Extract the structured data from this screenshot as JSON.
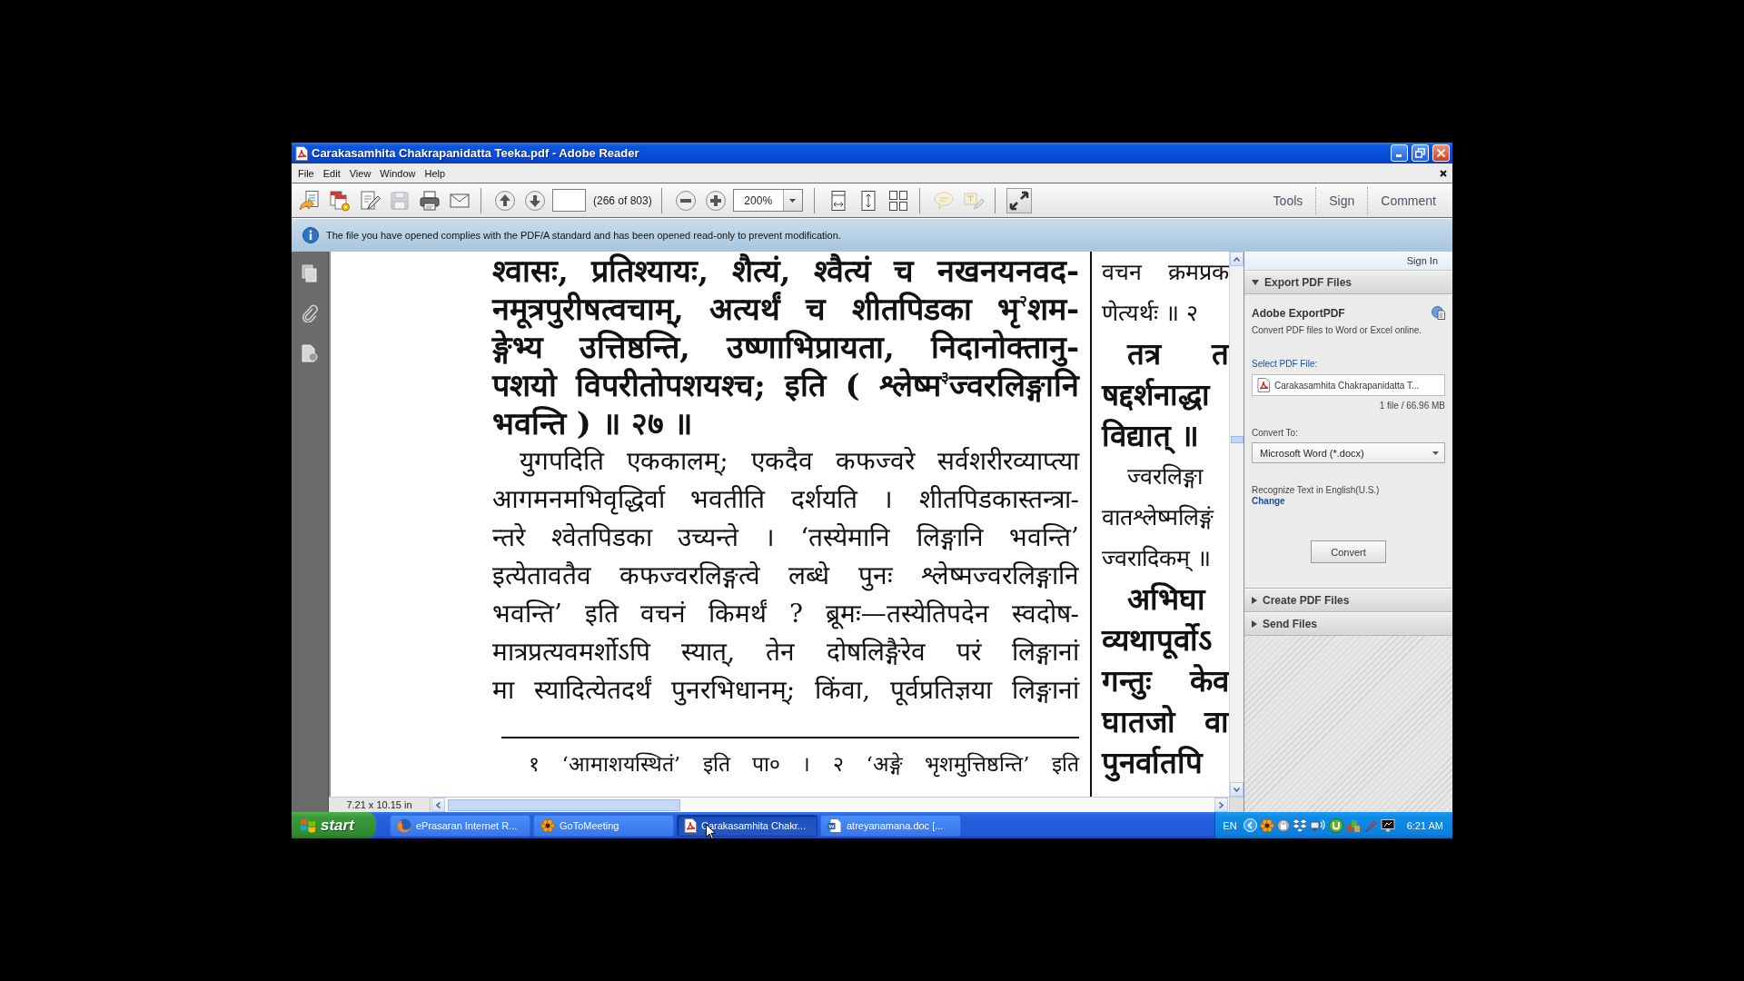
{
  "window": {
    "title": "Carakasamhita Chakrapanidatta Teeka.pdf - Adobe Reader"
  },
  "menu": [
    "File",
    "Edit",
    "View",
    "Window",
    "Help"
  ],
  "toolbar": {
    "file_tools": [
      {
        "kind": "open",
        "disabled": false
      },
      {
        "kind": "create",
        "disabled": false
      },
      {
        "kind": "edit",
        "disabled": false
      },
      {
        "kind": "save",
        "disabled": true
      },
      {
        "kind": "print",
        "disabled": false
      },
      {
        "kind": "email",
        "disabled": false
      }
    ],
    "page_tools": [
      {
        "kind": "previous",
        "disabled": false
      },
      {
        "kind": "next",
        "disabled": false
      }
    ],
    "page_count": "(266 of 803)",
    "zoom_tools": [
      {
        "kind": "zoom_out",
        "disabled": false
      },
      {
        "kind": "zoom_in",
        "disabled": false
      }
    ],
    "zoom": "200%",
    "view_tools": [
      {
        "kind": "fit_width",
        "disabled": false
      },
      {
        "kind": "fit_page",
        "disabled": false
      },
      {
        "kind": "spread",
        "disabled": false
      }
    ],
    "comment_tools": [
      {
        "kind": "note",
        "disabled": true
      },
      {
        "kind": "highlight",
        "disabled": true
      }
    ],
    "mode_tools": [
      {
        "kind": "full_screen",
        "disabled": false
      }
    ],
    "task_buttons": [
      "Tools",
      "Sign",
      "Comment"
    ]
  },
  "notice": "The file you have opened complies with the PDF/A standard and has been opened read-only to prevent modification.",
  "document": {
    "main_column": [
      {
        "kind": "verse",
        "continued": true,
        "runs_on": false,
        "lines": [
          "श्वासः, प्रतिश्यायः, शैत्यं, श्वैत्यं च नखनयनवद-",
          "नमूत्रपुरीषत्वचाम्, अत्यर्थं च शीतपिडका भृ$^{२}$शम-",
          "ङ्गेभ्य उत्तिष्ठन्ति, उष्णाभिप्रायता, निदानोक्तानु-",
          "पशयो विपरीतोपशयश्च; इति ( श्लेष्म$^{३}$ज्वरलिङ्गानि",
          "भवन्ति ) ॥ २७ ॥"
        ]
      },
      {
        "kind": "commentary",
        "continued": false,
        "runs_on": true,
        "lines": [
          "युगपदिति एककालम्; एकदैव कफज्वरे सर्वशरीरव्याप्त्या",
          "आगमनमभिवृद्धिर्वा भवतीति दर्शयति । शीतपिडकास्तन्त्रा-",
          "न्तरे श्वेतपिडका उच्यन्ते । ‘तस्येमानि लिङ्गानि भवन्ति’",
          "इत्येतावतैव कफज्वरलिङ्गत्वे लब्धे पुनः श्लेष्मज्वरलिङ्गानि",
          "भवन्ति’ इति वचनं किमर्थं ? ब्रूमः—तस्येतिपदेन स्वदोष-",
          "मात्रप्रत्यवमर्शोऽपि स्यात्, तेन दोषलिङ्गैरेव परं लिङ्गानां",
          "मा स्यादित्येतदर्थं पुनरभिधानम्; किंवा, पूर्वप्रतिज्ञया लिङ्गानां"
        ]
      }
    ],
    "footnote": "१ ‘आमाशयस्थितं’ इति पा० । २ ‘अङ्गे भृशमुत्तिष्ठन्ति’ इति",
    "side_column": [
      {
        "kind": "commentary",
        "continued": true,
        "runs_on": false,
        "lines": [
          "वचन क्रमप्रक",
          "णेत्यर्थः ॥ २"
        ]
      },
      {
        "kind": "verse",
        "continued": false,
        "runs_on": false,
        "lines": [
          "तत्र त",
          "षद्दर्शनाद्धा",
          "विद्यात् ॥"
        ]
      },
      {
        "kind": "commentary",
        "continued": false,
        "runs_on": false,
        "lines": [
          "ज्वरलिङ्गा",
          "वातश्लेष्मलिङ्गं",
          "ज्वरादिकम् ॥"
        ]
      },
      {
        "kind": "verse",
        "continued": false,
        "lines": [
          "अभिघा",
          "व्यथापूर्वोऽ",
          "गन्तुः केव",
          "घातजो वा",
          "पुनर्वातपि"
        ]
      }
    ]
  },
  "status": {
    "page_size": "7.21 x 10.15 in"
  },
  "right_pane": {
    "sign_in": "Sign In",
    "sections": [
      {
        "title": "Export PDF Files",
        "expanded": true,
        "content": {
          "heading": "Adobe ExportPDF",
          "description": "Convert PDF files to Word or Excel online.",
          "select_label": "Select PDF File:",
          "file_name": "Carakasamhita Chakrapanidatta T...",
          "file_info": "1 file / 66.96 MB",
          "convert_to_label": "Convert To:",
          "format": "Microsoft Word (*.docx)",
          "recognize": "Recognize Text in English(U.S.)",
          "change_link": "Change",
          "convert_button": "Convert"
        }
      },
      {
        "title": "Create PDF Files",
        "expanded": false
      },
      {
        "title": "Send Files",
        "expanded": false
      }
    ]
  },
  "taskbar": {
    "start": "start",
    "tasks": [
      {
        "label": "ePrasaran Internet R...",
        "kind": "browser",
        "selected": false
      },
      {
        "label": "GoToMeeting",
        "kind": "meeting",
        "selected": false
      },
      {
        "label": "Carakasamhita Chakr...",
        "kind": "pdf",
        "selected": true
      },
      {
        "label": "atreyanamana.doc [...",
        "kind": "doc",
        "selected": false
      }
    ],
    "language": "EN",
    "clock": "6:21 AM"
  }
}
